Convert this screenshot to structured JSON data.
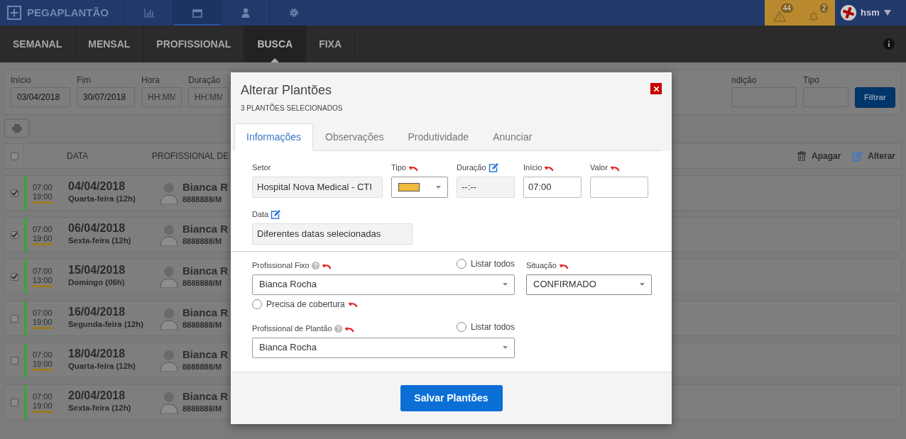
{
  "header": {
    "brand": "PEGAPLANTÃO",
    "nav": [
      {
        "kind": "chart",
        "selected": false
      },
      {
        "kind": "calendar",
        "selected": true
      },
      {
        "kind": "person",
        "selected": false
      },
      {
        "kind": "gear",
        "selected": false
      }
    ],
    "alerts": [
      {
        "kind": "warning",
        "count": "44"
      },
      {
        "kind": "bell",
        "count": "2"
      }
    ],
    "user": "hsm"
  },
  "tabs": [
    {
      "label": "SEMANAL",
      "selected": false
    },
    {
      "label": "MENSAL",
      "selected": false
    },
    {
      "label": "PROFISSIONAL",
      "selected": false
    },
    {
      "label": "BUSCA",
      "selected": true
    },
    {
      "label": "FIXA",
      "selected": false
    }
  ],
  "filters": [
    {
      "label": "Início",
      "value": "03/04/2018"
    },
    {
      "label": "Fim",
      "value": "30/07/2018"
    },
    {
      "label": "Hora",
      "placeholder": "HH:MM"
    },
    {
      "label": "Duração",
      "placeholder": "HH:MM"
    }
  ],
  "filters_right": [
    {
      "label": "ndição"
    },
    {
      "label": "Tipo"
    }
  ],
  "filter_button": "Filtrar",
  "table": {
    "all_checked": false,
    "columns": [
      "DATA",
      "PROFISSIONAL DE"
    ],
    "actions": [
      {
        "kind": "trash",
        "label": "Apagar"
      },
      {
        "kind": "edit",
        "label": "Alterar"
      }
    ],
    "rows": [
      {
        "checked": true,
        "start": "07:00",
        "end": "19:00",
        "date": "04/04/2018",
        "weekday": "Quarta-feira (12h)",
        "professional": "Bianca R",
        "registration": "8888888/M"
      },
      {
        "checked": true,
        "start": "07:00",
        "end": "19:00",
        "date": "06/04/2018",
        "weekday": "Sexta-feira (12h)",
        "professional": "Bianca R",
        "registration": "8888888/M"
      },
      {
        "checked": true,
        "start": "07:00",
        "end": "13:00",
        "date": "15/04/2018",
        "weekday": "Domingo (06h)",
        "professional": "Bianca R",
        "registration": "8888888/M"
      },
      {
        "checked": false,
        "start": "07:00",
        "end": "19:00",
        "date": "16/04/2018",
        "weekday": "Segunda-feira (12h)",
        "professional": "Bianca R",
        "registration": "8888888/M"
      },
      {
        "checked": false,
        "start": "07:00",
        "end": "19:00",
        "date": "18/04/2018",
        "weekday": "Quarta-feira (12h)",
        "professional": "Bianca R",
        "registration": "8888888/M"
      },
      {
        "checked": false,
        "start": "07:00",
        "end": "19:00",
        "date": "20/04/2018",
        "weekday": "Sexta-feira (12h)",
        "professional": "Bianca R",
        "registration": "8888888/M"
      }
    ]
  },
  "modal": {
    "title": "Alterar Plantões",
    "subtitle": "3 PLANTÕES SELECIONADOS",
    "tabs": [
      {
        "label": "Informações",
        "selected": true
      },
      {
        "label": "Observações",
        "selected": false
      },
      {
        "label": "Produtividade",
        "selected": false
      },
      {
        "label": "Anunciar",
        "selected": false
      }
    ],
    "row1": [
      {
        "label": "Setor",
        "kind": "text",
        "value": "Hospital Nova Medical - CTI",
        "disabled": true
      },
      {
        "label": "Tipo",
        "kind": "color",
        "color": "#f0b93f",
        "revertible": true
      },
      {
        "label": "Duração",
        "kind": "text",
        "value": "--:--",
        "disabled": true,
        "editable": true
      },
      {
        "label": "Início",
        "kind": "text",
        "value": "07:00",
        "disabled": false,
        "revertible": true
      },
      {
        "label": "Valor",
        "kind": "text",
        "disabled": false,
        "revertible": true
      }
    ],
    "date": {
      "label": "Data",
      "value": "Diferentes datas selecionadas",
      "editable": true
    },
    "fixed": {
      "label": "Profissional Fixo",
      "help": true,
      "revertible": true,
      "list_all": {
        "label": "Listar todos",
        "checked": false
      },
      "value": "Bianca Rocha",
      "coverage": {
        "label": "Precisa de cobertura",
        "checked": false,
        "revertible": true
      }
    },
    "status": {
      "label": "Situação",
      "revertible": true,
      "value": "CONFIRMADO"
    },
    "on_duty": {
      "label": "Profissional de Plantão",
      "help": true,
      "revertible": true,
      "list_all": {
        "label": "Listar todos",
        "checked": false
      },
      "value": "Bianca Rocha"
    },
    "save": "Salvar Plantões"
  }
}
